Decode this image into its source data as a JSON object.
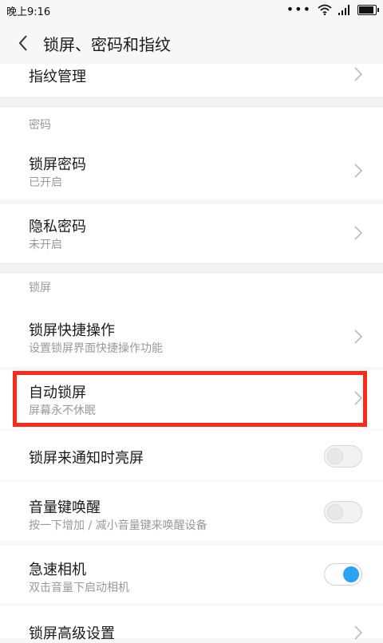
{
  "status_bar": {
    "time": "晚上9:16",
    "dots": "•••"
  },
  "header": {
    "title": "锁屏、密码和指纹"
  },
  "items": {
    "fingerprint": {
      "label": "指纹管理"
    },
    "section_password": "密码",
    "lock_password": {
      "label": "锁屏密码",
      "sub": "已开启"
    },
    "privacy_password": {
      "label": "隐私密码",
      "sub": "未开启"
    },
    "section_lock": "锁屏",
    "lock_shortcut": {
      "label": "锁屏快捷操作",
      "sub": "设置锁屏界面快捷操作功能"
    },
    "auto_lock": {
      "label": "自动锁屏",
      "sub": "屏幕永不休眠"
    },
    "notify_wake": {
      "label": "锁屏来通知时亮屏",
      "on": false
    },
    "volume_wake": {
      "label": "音量键唤醒",
      "sub": "按一下增加 / 减小音量键来唤醒设备",
      "on": false
    },
    "quick_camera": {
      "label": "急速相机",
      "sub": "双击音量下启动相机",
      "on": true
    },
    "advanced": {
      "label": "锁屏高级设置"
    }
  },
  "colors": {
    "accent": "#2aa3f5",
    "highlight": "#ff2a1a"
  }
}
